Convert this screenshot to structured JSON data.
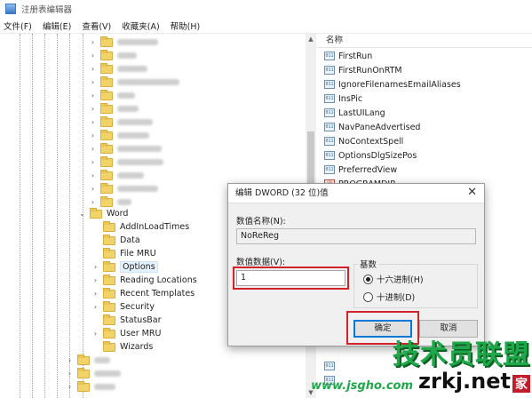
{
  "window": {
    "title": "注册表编辑器"
  },
  "menu": [
    "文件(F)",
    "编辑(E)",
    "查看(V)",
    "收藏夹(A)",
    "帮助(H)"
  ],
  "tree": {
    "parent": "Word",
    "children": [
      {
        "label": "AddInLoadTimes",
        "expandable": false
      },
      {
        "label": "Data",
        "expandable": false
      },
      {
        "label": "File MRU",
        "expandable": false
      },
      {
        "label": "Options",
        "expandable": true,
        "selected": true
      },
      {
        "label": "Reading Locations",
        "expandable": true
      },
      {
        "label": "Recent Templates",
        "expandable": true
      },
      {
        "label": "Security",
        "expandable": true
      },
      {
        "label": "StatusBar",
        "expandable": false
      },
      {
        "label": "User MRU",
        "expandable": true
      },
      {
        "label": "Wizards",
        "expandable": false
      }
    ]
  },
  "values": {
    "header": "名称",
    "items": [
      {
        "name": "FirstRun",
        "icon": "binary-value-icon"
      },
      {
        "name": "FirstRunOnRTM",
        "icon": "binary-value-icon"
      },
      {
        "name": "IgnoreFilenamesEmailAliases",
        "icon": "binary-value-icon"
      },
      {
        "name": "InsPic",
        "icon": "binary-value-icon"
      },
      {
        "name": "LastUILang",
        "icon": "binary-value-icon"
      },
      {
        "name": "NavPaneAdvertised",
        "icon": "binary-value-icon"
      },
      {
        "name": "NoContextSpell",
        "icon": "binary-value-icon"
      },
      {
        "name": "OptionsDlgSizePos",
        "icon": "binary-value-icon"
      },
      {
        "name": "PreferredView",
        "icon": "binary-value-icon"
      },
      {
        "name": "PROGRAMDIR",
        "icon": "string-value-icon"
      }
    ]
  },
  "dialog": {
    "title": "编辑 DWORD (32 位)值",
    "close": "✕",
    "value_name_label": "数值名称(N):",
    "value_name": "NoReReg",
    "value_data_label": "数值数据(V):",
    "value_data": "1",
    "base_label": "基数",
    "base_hex": "十六进制(H)",
    "base_dec": "十进制(D)",
    "selected_base": "hex",
    "ok": "确定",
    "cancel": "取消"
  },
  "watermark": {
    "line1": "技术员联盟",
    "site": "www.jsgho.com",
    "brand": "zrkj",
    "brand_suffix": ".net",
    "jia": "家"
  }
}
